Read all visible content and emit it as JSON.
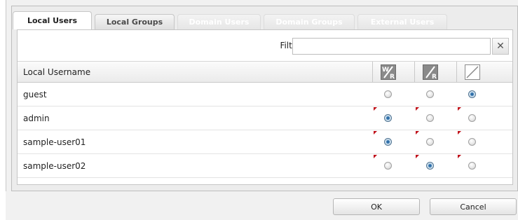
{
  "tabs": [
    {
      "label": "Local Users",
      "state": "active"
    },
    {
      "label": "Local Groups",
      "state": "normal"
    },
    {
      "label": "Domain Users",
      "state": "disabled"
    },
    {
      "label": "Domain Groups",
      "state": "disabled"
    },
    {
      "label": "External Users",
      "state": "disabled"
    }
  ],
  "filter": {
    "label": "Filter:",
    "value": "",
    "clear_icon": "close-icon"
  },
  "grid": {
    "name_header": "Local Username",
    "permission_columns": [
      {
        "icon": "read-write-icon",
        "meaning": "W/R"
      },
      {
        "icon": "read-only-icon",
        "meaning": "R"
      },
      {
        "icon": "no-access-icon",
        "meaning": "none"
      }
    ],
    "rows": [
      {
        "name": "guest",
        "selected": 2,
        "flags": [
          false,
          false,
          false
        ]
      },
      {
        "name": "admin",
        "selected": 0,
        "flags": [
          true,
          true,
          true
        ]
      },
      {
        "name": "sample-user01",
        "selected": 0,
        "flags": [
          true,
          true,
          true
        ]
      },
      {
        "name": "sample-user02",
        "selected": 1,
        "flags": [
          true,
          true,
          true
        ]
      }
    ]
  },
  "footer": {
    "ok_label": "OK",
    "cancel_label": "Cancel"
  },
  "colors": {
    "radio_selected": "#2e6ea8",
    "change_flag": "#c0101a"
  }
}
